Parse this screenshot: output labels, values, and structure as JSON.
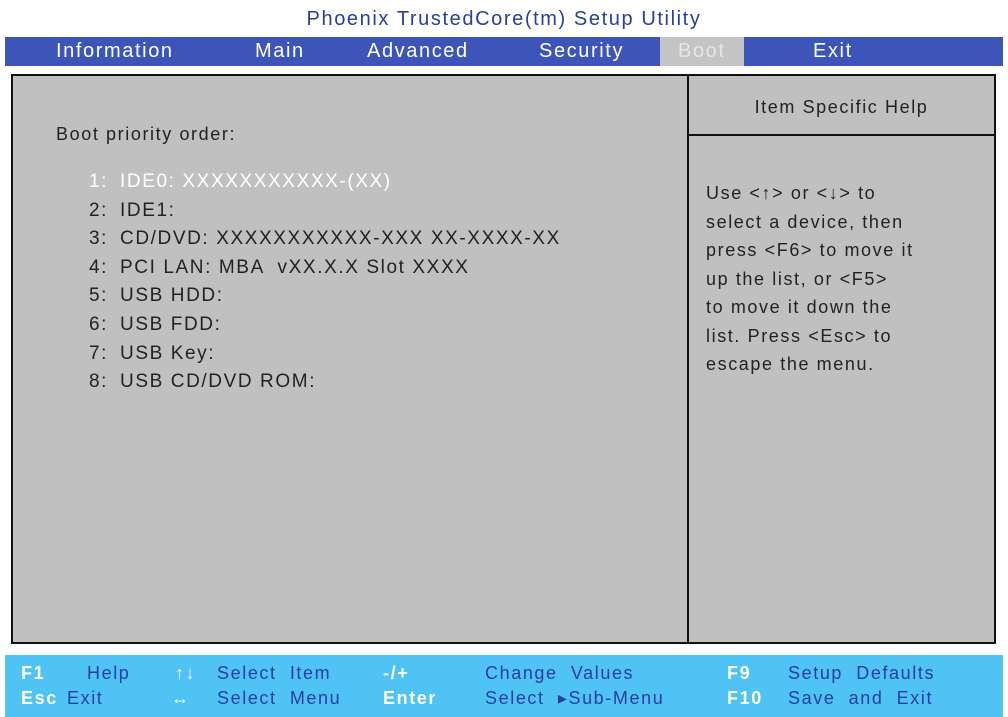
{
  "app": {
    "title": "Phoenix TrustedCore(tm) Setup Utility"
  },
  "menu": {
    "tabs": [
      {
        "label": "Information"
      },
      {
        "label": "Main"
      },
      {
        "label": "Advanced"
      },
      {
        "label": "Security"
      },
      {
        "label": "Boot",
        "active": true
      },
      {
        "label": "Exit"
      }
    ]
  },
  "boot": {
    "priority_label": "Boot priority order:",
    "items": [
      {
        "num": "1:",
        "device": "IDE0: XXXXXXXXXXX-(XX)",
        "selected": true
      },
      {
        "num": "2:",
        "device": "IDE1:"
      },
      {
        "num": "3:",
        "device": "CD/DVD: XXXXXXXXXXX-XXX XX-XXXX-XX"
      },
      {
        "num": "4:",
        "device": "PCI LAN: MBA  vXX.X.X Slot XXXX"
      },
      {
        "num": "5:",
        "device": "USB HDD:"
      },
      {
        "num": "6:",
        "device": "USB FDD:"
      },
      {
        "num": "7:",
        "device": "USB Key:"
      },
      {
        "num": "8:",
        "device": "USB CD/DVD ROM:"
      }
    ]
  },
  "help": {
    "title": "Item Specific Help",
    "text": "Use <↑> or <↓> to\nselect a device, then\npress <F6> to move it\nup the list, or <F5>\nto move it down the\nlist. Press <Esc> to\nescape the menu."
  },
  "footer": {
    "row1": {
      "f1_key": "F1",
      "f1_label": "Help",
      "updown_key": "↑↓",
      "updown_label": "Select  Item",
      "plusminus_key": "-/+",
      "plusminus_label": "Change  Values",
      "f9_key": "F9",
      "f9_label": "Setup  Defaults"
    },
    "row2": {
      "esc_key": "Esc",
      "esc_label": "Exit",
      "leftright_key": "↔",
      "leftright_label": "Select  Menu",
      "enter_key": "Enter",
      "enter_label": "Select  ▸Sub-Menu",
      "f10_key": "F10",
      "f10_label": "Save  and  Exit"
    }
  }
}
